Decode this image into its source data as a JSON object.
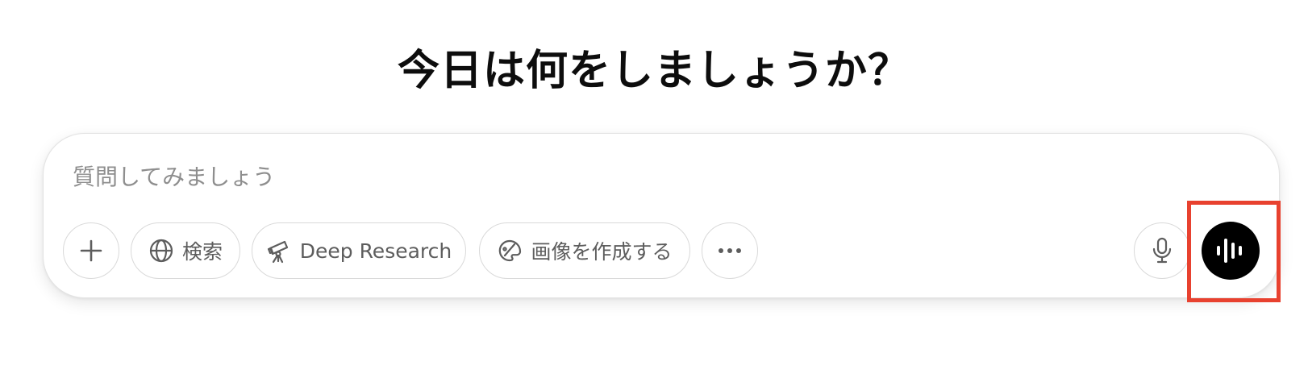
{
  "heading": "今日は何をしましょうか？",
  "composer": {
    "placeholder": "質問してみましょう",
    "value": ""
  },
  "toolbar": {
    "add_icon": "plus-icon",
    "search": {
      "label": "検索",
      "icon": "globe-icon"
    },
    "deep_research": {
      "label": "Deep Research",
      "icon": "telescope-icon"
    },
    "create_image": {
      "label": "画像を作成する",
      "icon": "paint-palette-icon"
    },
    "more_icon": "ellipsis-icon",
    "mic_icon": "microphone-icon",
    "voice_icon": "waveform-icon"
  },
  "colors": {
    "highlight": "#e8412f",
    "voice_button": "#000000",
    "pill_text": "#5d5d5d",
    "placeholder": "#8e8e8e"
  }
}
